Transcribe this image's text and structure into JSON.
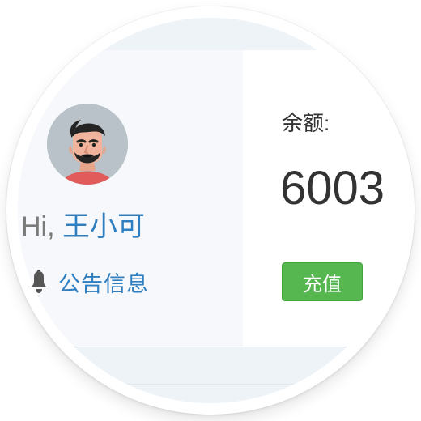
{
  "user": {
    "greeting_prefix": "Hi, ",
    "name": "王小可"
  },
  "notice": {
    "label": "公告信息",
    "icon": "bell-icon"
  },
  "balance": {
    "label": "余额:",
    "value": "6003"
  },
  "actions": {
    "recharge_label": "充值"
  },
  "colors": {
    "accent_blue": "#2f7ec0",
    "button_green": "#56b64f",
    "panel_left": "#f6f8fb",
    "band": "#eef3f8"
  }
}
